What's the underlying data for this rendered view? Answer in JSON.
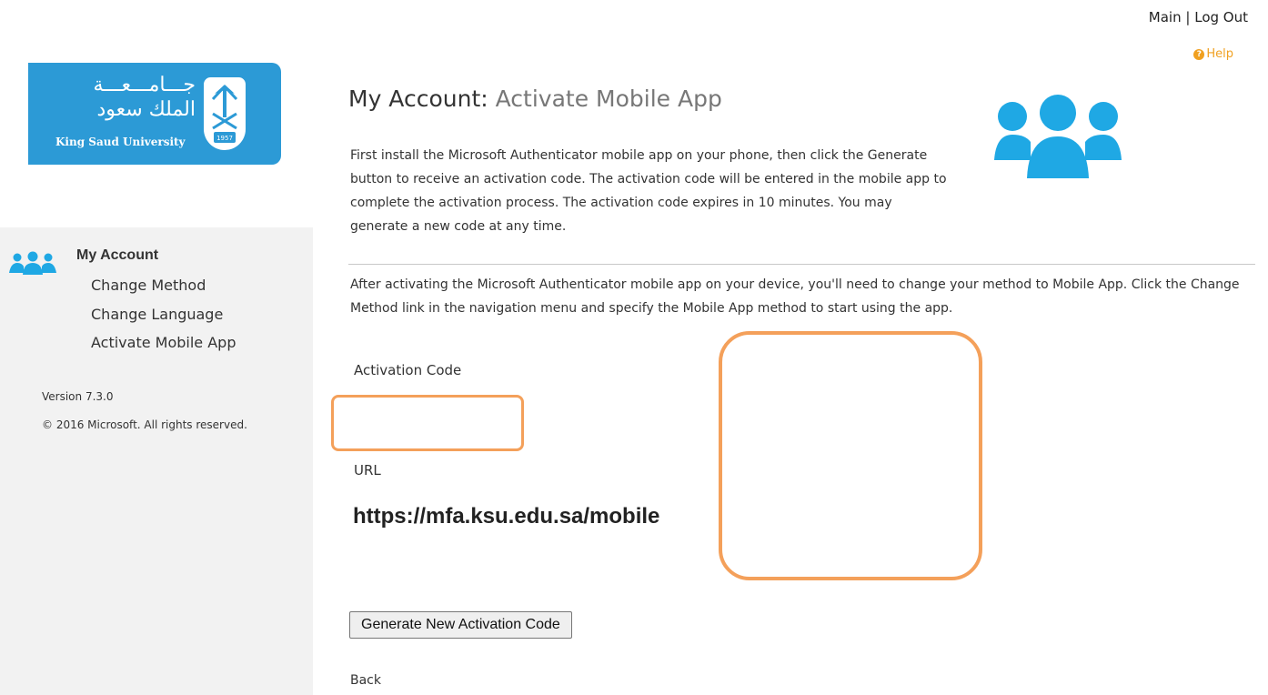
{
  "header": {
    "main_link": "Main",
    "separator": "|",
    "logout_link": "Log Out",
    "help_link": "Help"
  },
  "logo": {
    "arabic_line1": "جـــامـــعـــة",
    "arabic_line2": "الملك سعود",
    "english_name": "King Saud University",
    "emblem_year": "1957"
  },
  "sidebar": {
    "section_title": "My Account",
    "items": [
      {
        "label": "Change Method"
      },
      {
        "label": "Change Language"
      },
      {
        "label": "Activate Mobile App"
      }
    ],
    "version": "Version 7.3.0",
    "copyright": "© 2016 Microsoft. All rights reserved."
  },
  "main": {
    "title_prefix": "My Account:",
    "title_page": "Activate Mobile App",
    "intro": "First install the Microsoft Authenticator mobile app on your phone, then click the Generate button to receive an activation code. The activation code will be entered in the mobile app to complete the activation process. The activation code expires in 10 minutes. You may generate a new code at any time.",
    "after_activation": "After activating the Microsoft Authenticator mobile app on your device, you'll need to change your method to Mobile App. Click the Change Method link in the navigation menu and specify the Mobile App method to start using the app.",
    "activation_code_label": "Activation Code",
    "activation_code_value": "",
    "url_label": "URL",
    "url_value": "https://mfa.ksu.edu.sa/mobile",
    "generate_button": "Generate New Activation Code",
    "back_link": "Back"
  },
  "colors": {
    "brand_blue": "#2c9ad6",
    "icon_blue": "#1fa8e4",
    "highlight_orange": "#f4a05a",
    "help_orange": "#f0a020"
  },
  "icons": [
    "help-icon",
    "users-icon",
    "sidebar-users-icon",
    "university-emblem"
  ]
}
